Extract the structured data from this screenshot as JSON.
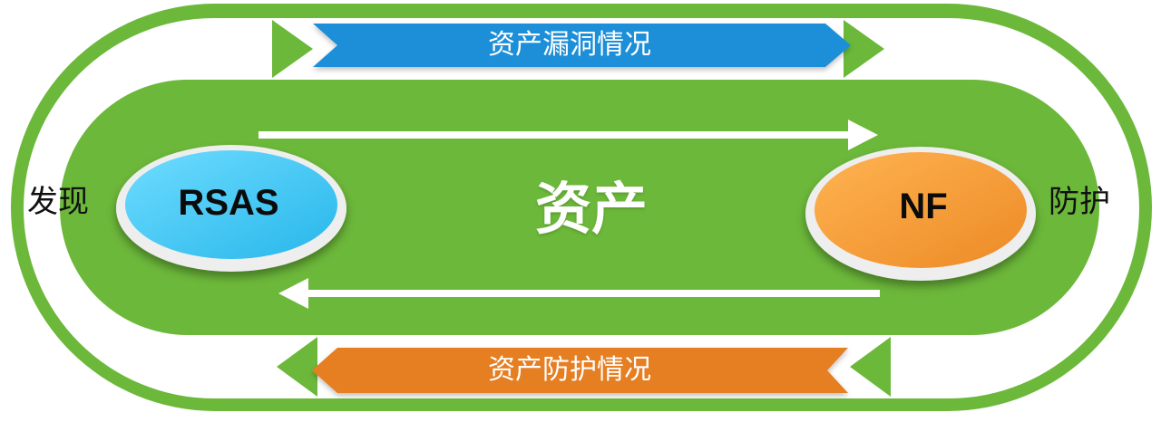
{
  "left_label": "发现",
  "right_label": "防护",
  "center_label": "资产",
  "nodes": {
    "left": {
      "label": "RSAS",
      "color": "#48cdf3"
    },
    "right": {
      "label": "NF",
      "color": "#f4a33d"
    }
  },
  "banners": {
    "top": {
      "label": "资产漏洞情况",
      "color": "#1f8fd8"
    },
    "bottom": {
      "label": "资产防护情况",
      "color": "#e67e22"
    }
  },
  "colors": {
    "track_green": "#6cb83a",
    "arrow_white": "#ffffff"
  }
}
